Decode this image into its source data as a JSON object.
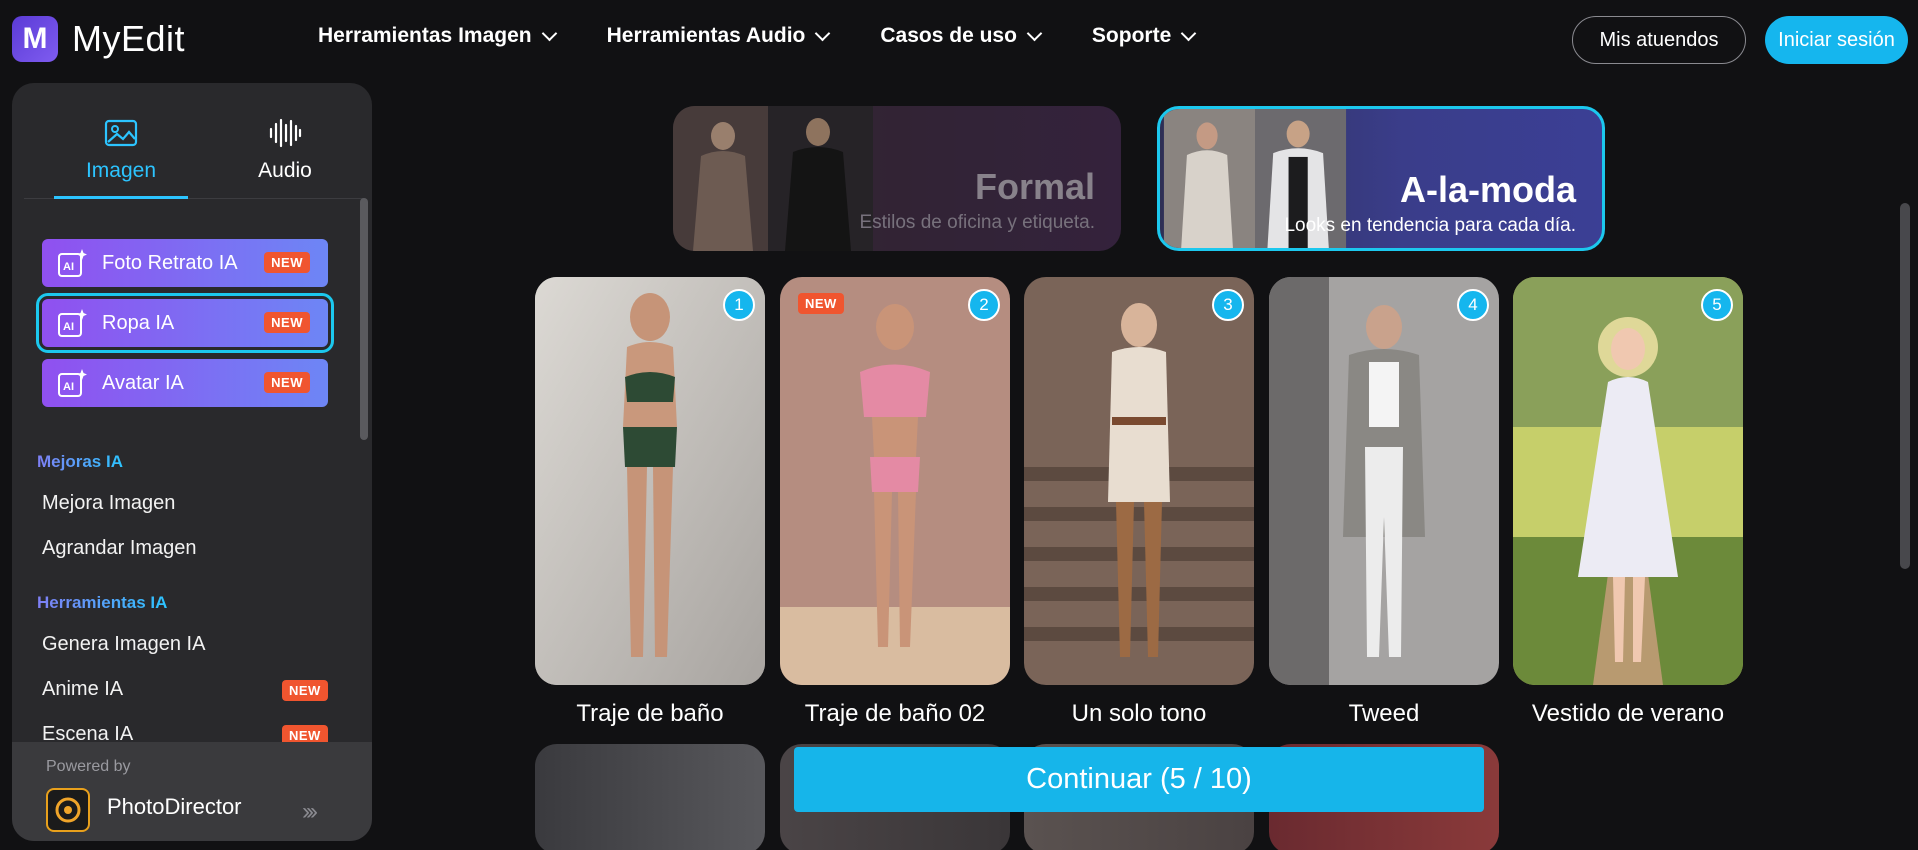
{
  "brand": {
    "logo_letter": "M",
    "name": "MyEdit"
  },
  "nav": {
    "items": [
      {
        "label": "Herramientas Imagen"
      },
      {
        "label": "Herramientas Audio"
      },
      {
        "label": "Casos de uso"
      },
      {
        "label": "Soporte"
      }
    ],
    "my_outfits": "Mis atuendos",
    "login": "Iniciar sesión"
  },
  "sidebar": {
    "tabs": [
      {
        "label": "Imagen"
      },
      {
        "label": "Audio"
      }
    ],
    "ai_tools": [
      {
        "label": "Foto Retrato IA",
        "badge": "NEW"
      },
      {
        "label": "Ropa IA",
        "badge": "NEW"
      },
      {
        "label": "Avatar IA",
        "badge": "NEW"
      }
    ],
    "sections": [
      {
        "title": "Mejoras IA",
        "links": [
          {
            "label": "Mejora Imagen"
          },
          {
            "label": "Agrandar Imagen"
          }
        ]
      },
      {
        "title": "Herramientas IA",
        "links": [
          {
            "label": "Genera Imagen IA"
          },
          {
            "label": "Anime IA",
            "badge": "NEW"
          },
          {
            "label": "Escena IA",
            "badge": "NEW"
          }
        ]
      }
    ],
    "footer": {
      "powered_by": "Powered by",
      "product": "PhotoDirector"
    }
  },
  "styles": [
    {
      "title": "Formal",
      "subtitle": "Estilos de oficina y etiqueta."
    },
    {
      "title": "A-la-moda",
      "subtitle": "Looks en tendencia para cada día."
    }
  ],
  "outfits": [
    {
      "number": "1",
      "label": "Traje de baño"
    },
    {
      "number": "2",
      "label": "Traje de baño 02",
      "badge": "NEW"
    },
    {
      "number": "3",
      "label": "Un solo tono"
    },
    {
      "number": "4",
      "label": "Tweed"
    },
    {
      "number": "5",
      "label": "Vestido de verano"
    }
  ],
  "continue_label": "Continuar (5 / 10)",
  "colors": {
    "accent": "#15b6ee",
    "badge": "#f0552f",
    "ai_gradient_start": "#9050f0",
    "ai_gradient_end": "#6d86f5"
  }
}
